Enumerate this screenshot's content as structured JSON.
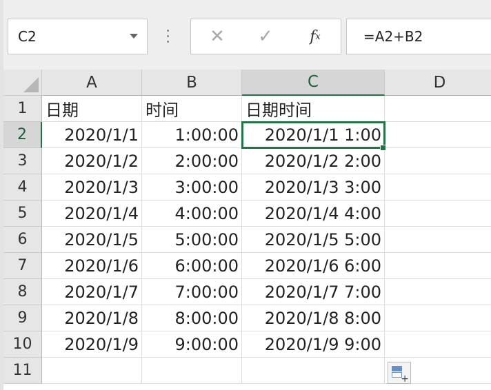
{
  "name_box": {
    "value": "C2"
  },
  "formula_bar": {
    "cancel_symbol": "✕",
    "enter_symbol": "✓",
    "fx_label": "f",
    "fx_sub": "x",
    "formula": "=A2+B2"
  },
  "columns": [
    "A",
    "B",
    "C",
    "D"
  ],
  "rows": [
    "1",
    "2",
    "3",
    "4",
    "5",
    "6",
    "7",
    "8",
    "9",
    "10",
    "11"
  ],
  "sheet": {
    "headers": {
      "A": "日期",
      "B": "时间",
      "C": "日期时间"
    },
    "data": [
      {
        "A": "2020/1/1",
        "B": "1:00:00",
        "C": "2020/1/1 1:00"
      },
      {
        "A": "2020/1/2",
        "B": "2:00:00",
        "C": "2020/1/2 2:00"
      },
      {
        "A": "2020/1/3",
        "B": "3:00:00",
        "C": "2020/1/3 3:00"
      },
      {
        "A": "2020/1/4",
        "B": "4:00:00",
        "C": "2020/1/4 4:00"
      },
      {
        "A": "2020/1/5",
        "B": "5:00:00",
        "C": "2020/1/5 5:00"
      },
      {
        "A": "2020/1/6",
        "B": "6:00:00",
        "C": "2020/1/6 6:00"
      },
      {
        "A": "2020/1/7",
        "B": "7:00:00",
        "C": "2020/1/7 7:00"
      },
      {
        "A": "2020/1/8",
        "B": "8:00:00",
        "C": "2020/1/8 8:00"
      },
      {
        "A": "2020/1/9",
        "B": "9:00:00",
        "C": "2020/1/9 9:00"
      }
    ]
  },
  "selection": {
    "cell": "C2"
  },
  "colors": {
    "accent": "#217346",
    "header_bg": "#e6e6e6",
    "gridline": "#dcdcdc"
  },
  "icons": {
    "namebox_dropdown": "chevron-down-icon",
    "paste_options": "paste-options-icon"
  }
}
